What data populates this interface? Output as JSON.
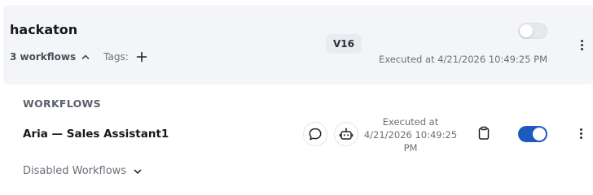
{
  "project": {
    "title": "hackaton",
    "workflow_count": "3 workflows",
    "tags_label": "Tags:",
    "version": "V16",
    "enabled": false,
    "executed": "Executed at 4/21/2026 10:49:25 PM"
  },
  "workflows_section": {
    "header": "WORKFLOWS",
    "items": [
      {
        "name": "Aria — Sales Assistant1",
        "executed_line1": "Executed at",
        "executed_line2": "4/21/2026 10:49:25",
        "executed_line3": "PM",
        "enabled": true
      }
    ]
  },
  "disabled_section": {
    "label": "Disabled Workflows"
  },
  "colors": {
    "card_bg": "#f4f5f8",
    "toggle_on": "#1c5bbd",
    "toggle_off": "#e6e8ec",
    "muted_text": "#6a707a"
  },
  "icons": {
    "collapse": "chevron-up-icon",
    "add_tag": "plus-icon",
    "chat": "chat-bubble-icon",
    "bot": "robot-icon",
    "copy": "clipboard-icon",
    "menu": "kebab-menu-icon",
    "expand": "chevron-down-icon"
  }
}
